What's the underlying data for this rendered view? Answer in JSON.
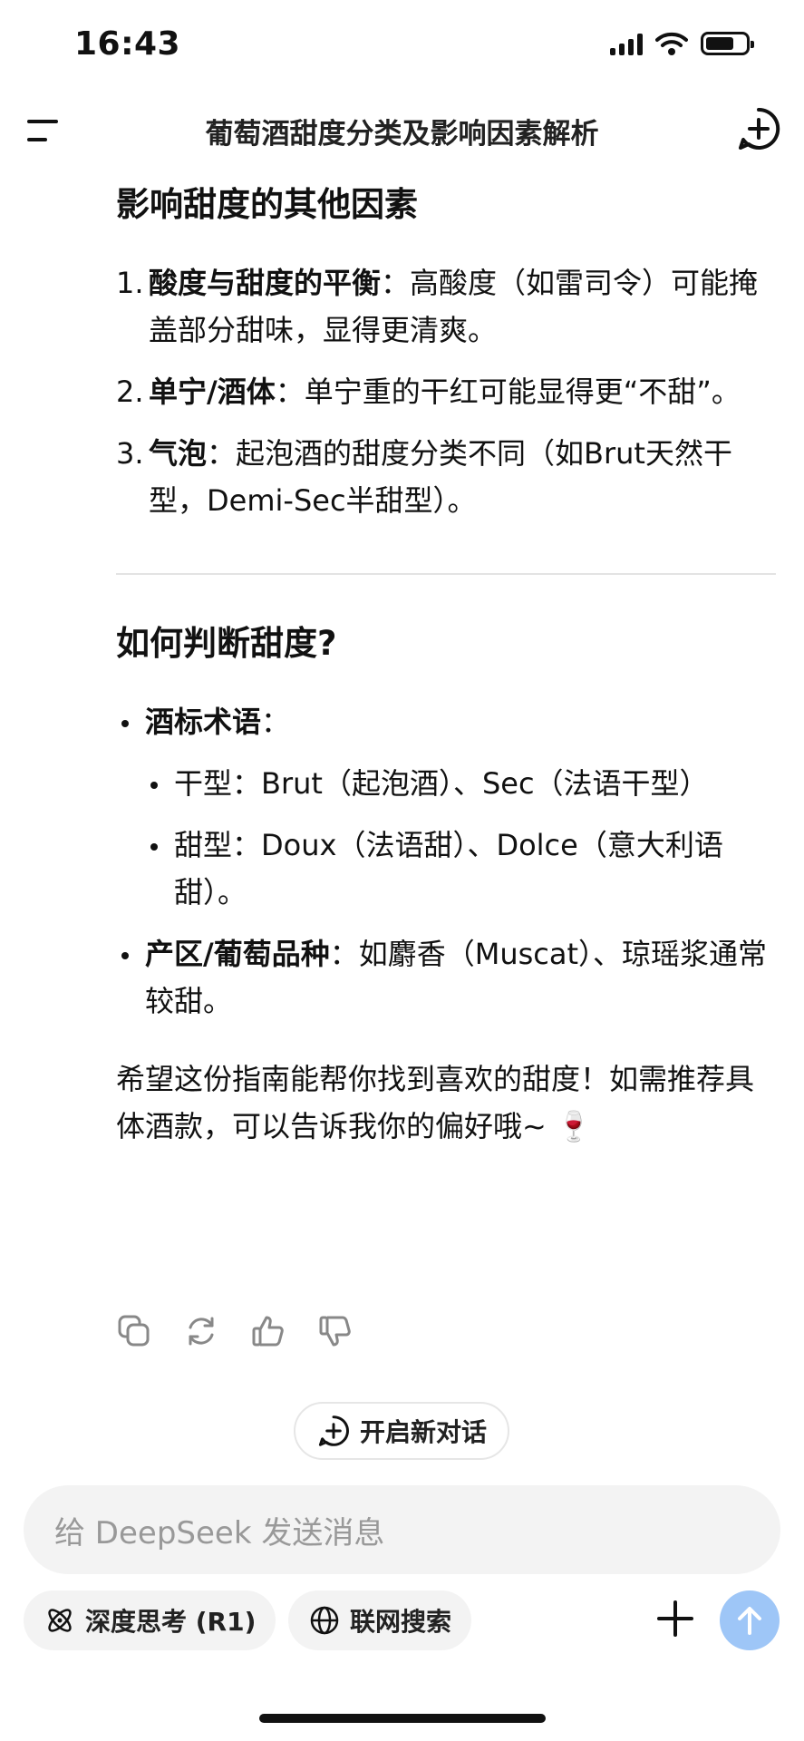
{
  "status_bar": {
    "time": "16:43"
  },
  "header": {
    "title": "葡萄酒甜度分类及影响因素解析"
  },
  "section_factors": {
    "heading": "影响甜度的其他因素",
    "items": [
      {
        "num": "1.",
        "term": "酸度与甜度的平衡",
        "sep": "：",
        "text": "高酸度（如雷司令）可能掩盖部分甜味，显得更清爽。"
      },
      {
        "num": "2.",
        "term": "单宁/酒体",
        "sep": "：",
        "text": "单宁重的干红可能显得更“不甜”。"
      },
      {
        "num": "3.",
        "term": "气泡",
        "sep": "：",
        "text": "起泡酒的甜度分类不同（如Brut天然干型，Demi-Sec半甜型）。"
      }
    ]
  },
  "section_judge": {
    "heading": "如何判断甜度?",
    "label_terms": {
      "term": "酒标术语",
      "sep": "："
    },
    "sub_items": [
      {
        "text": "干型：Brut（起泡酒）、Sec（法语干型）"
      },
      {
        "text": "甜型：Doux（法语甜）、Dolce（意大利语甜）。"
      }
    ],
    "region": {
      "term": "产区/葡萄品种",
      "sep": "：",
      "text": "如麝香（Muscat）、琼瑶浆通常较甜。"
    }
  },
  "closing": {
    "text": "希望这份指南能帮你找到喜欢的甜度！如需推荐具体酒款，可以告诉我你的偏好哦~ 🍷"
  },
  "new_chat": {
    "label": "开启新对话"
  },
  "composer": {
    "placeholder": "给 DeepSeek 发送消息",
    "deep_think_label": "深度思考 (R1)",
    "web_search_label": "联网搜索"
  },
  "colors": {
    "send_button": "#9ec6f7",
    "input_bg": "#f3f3f3",
    "divider": "#e3e3e3"
  }
}
